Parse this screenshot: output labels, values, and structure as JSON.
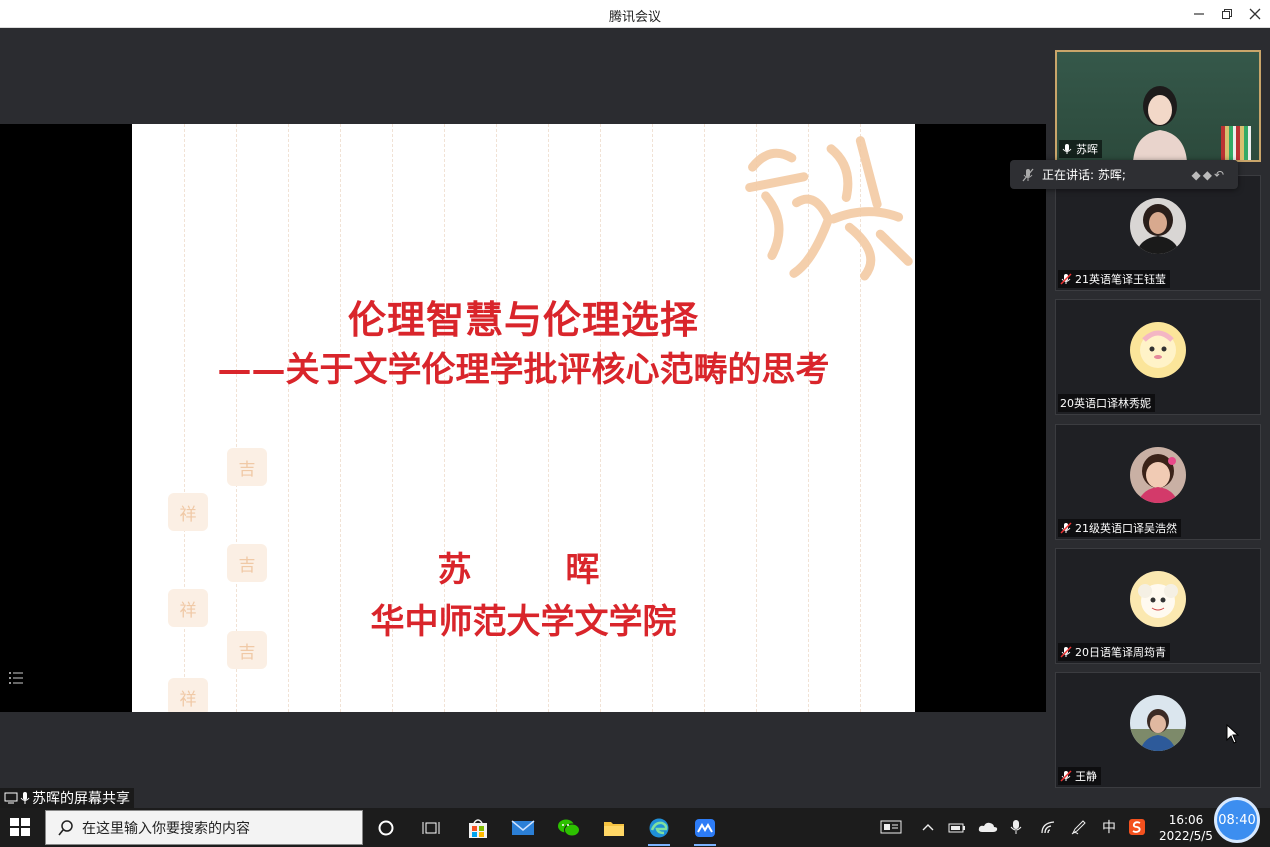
{
  "window": {
    "title": "腾讯会议"
  },
  "slide": {
    "title": "伦理智慧与伦理选择",
    "subtitle": "——关于文学伦理学批评核心范畴的思考",
    "author": "苏　晖",
    "affiliation": "华中师范大学文学院"
  },
  "share": {
    "label": "苏晖的屏幕共享"
  },
  "speaking": {
    "label": "正在讲话: 苏晖;"
  },
  "participants": [
    {
      "name": "苏晖",
      "muted": false
    },
    {
      "name": "21英语笔译王钰莹",
      "muted": true
    },
    {
      "name": "20英语口译林秀妮",
      "muted": true
    },
    {
      "name": "21级英语口译吴浩然",
      "muted": true
    },
    {
      "name": "20日语笔译周筠青",
      "muted": true
    },
    {
      "name": "王静",
      "muted": true
    }
  ],
  "taskbar": {
    "search_placeholder": "在这里输入你要搜索的内容",
    "ime": "中",
    "time": "16:06",
    "date": "2022/5/5",
    "timer": "08:40"
  },
  "colors": {
    "accent": "#d9252b",
    "timer": "#3c8ef0"
  }
}
